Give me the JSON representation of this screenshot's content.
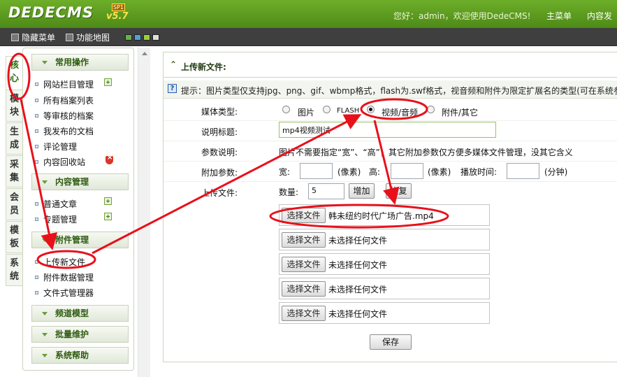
{
  "header": {
    "logo": "DEDECMS",
    "version": "v5.7",
    "edition": "SP1",
    "welcome": "您好：admin，欢迎使用DedeCMS!",
    "nav": [
      "主菜单",
      "内容发"
    ]
  },
  "toolbar": {
    "hide_menu": "隐藏菜单",
    "site_map": "功能地图",
    "skin_colors": [
      "#6ab04c",
      "#4aa3d8",
      "#9ccc3a",
      "#dddddd"
    ]
  },
  "left_tabs": [
    "核心",
    "模块",
    "生成",
    "采集",
    "会员",
    "模板",
    "系统"
  ],
  "menu": {
    "sections": [
      {
        "title": "常用操作",
        "items": [
          "网站栏目管理",
          "所有档案列表",
          "等审核的档案",
          "我发布的文档",
          "评论管理",
          "内容回收站"
        ]
      },
      {
        "title": "内容管理",
        "items": [
          "普通文章",
          "专题管理"
        ]
      },
      {
        "title": "附件管理",
        "items": [
          "上传新文件",
          "附件数据管理",
          "文件式管理器"
        ]
      },
      {
        "title": "频道模型",
        "items": []
      },
      {
        "title": "批量维护",
        "items": []
      },
      {
        "title": "系统帮助",
        "items": []
      }
    ]
  },
  "main": {
    "title": "上传新文件:",
    "tip": "提示：图片类型仅支持jpg、png、gif、wbmp格式，flash为.swf格式，视音频和附件为限定扩展名的类型(可在系统参数",
    "media_type_label": "媒体类型:",
    "media_options": [
      "图片",
      "FLASH",
      "视频/音频",
      "附件/其它"
    ],
    "selected_media": "视频/音频",
    "caption_label": "说明标题:",
    "caption_value": "mp4视频测试",
    "param_label": "参数说明:",
    "param_desc": "图片不需要指定“宽”、“高”，其它附加参数仅方便多媒体文件管理，没其它含义",
    "extra_label": "附加参数:",
    "width_label": "宽:",
    "height_label": "高:",
    "unit_px": "(像素)",
    "play_time_label": "播放时间:",
    "unit_min": "(分钟)",
    "upload_label": "上传文件:",
    "count_label": "数量:",
    "count_value": "5",
    "add_button": "增加",
    "restore_button": "恢复",
    "choose_file_button": "选择文件",
    "files": [
      "韩未纽约时代广场广告.mp4",
      "未选择任何文件",
      "未选择任何文件",
      "未选择任何文件",
      "未选择任何文件"
    ],
    "save_button": "保存"
  },
  "annotation_color": "#e8101b"
}
